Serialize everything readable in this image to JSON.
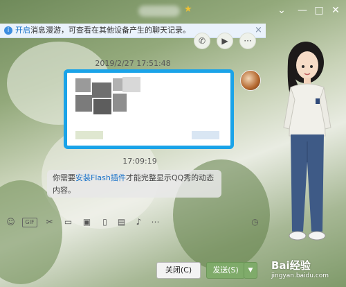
{
  "notice": {
    "link_text": "开启",
    "rest_text": "消息漫游，可查看在其他设备产生的聊天记录。",
    "close_glyph": "×"
  },
  "window": {
    "minimize_glyph": "—",
    "maximize_glyph": "□",
    "close_glyph": "✕",
    "dropdown_glyph": "⌄"
  },
  "header_tools": {
    "call_glyph": "✆",
    "video_glyph": "▶",
    "more_glyph": "···"
  },
  "chat": {
    "timestamp_1": "2019/2/27 17:51:48",
    "timestamp_2": "17:09:19",
    "received_prefix": "你需要",
    "received_link": "安装Flash插件",
    "received_suffix": "才能完整显示QQ秀的动态内容。"
  },
  "toolbar": {
    "emoji": "☺",
    "gif": "GIF",
    "scissors": "✂",
    "folder": "▭",
    "image": "▣",
    "shake": "▯",
    "red_packet": "▤",
    "music": "♪",
    "more": "⋯",
    "history": "◷"
  },
  "buttons": {
    "close_label": "关闭(C)",
    "send_label": "发送(S)",
    "send_arrow": "▼"
  },
  "watermark": {
    "brand": "Bai经验",
    "url": "jingyan.baidu.com"
  },
  "colors": {
    "accent": "#1aa3e8",
    "send_button": "#7fab6a",
    "link": "#1a73c9"
  }
}
